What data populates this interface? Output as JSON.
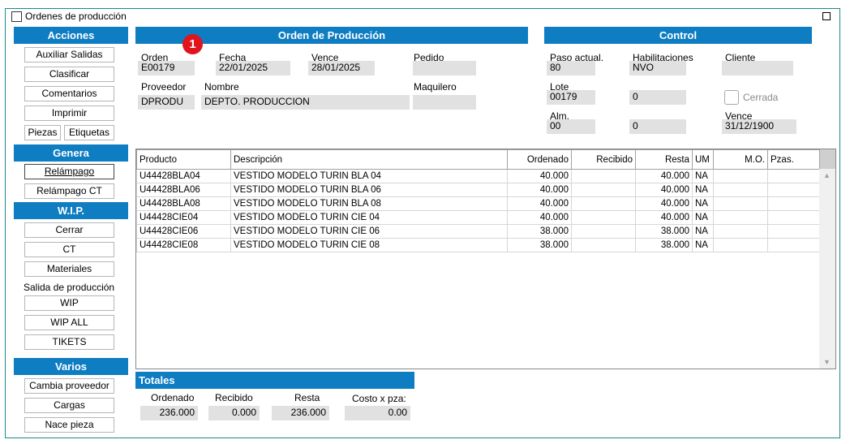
{
  "window": {
    "title": "Ordenes de producción"
  },
  "sidebar": {
    "acciones": {
      "title": "Acciones",
      "auxiliar": "Auxiliar Salidas",
      "clasificar": "Clasificar",
      "comentarios": "Comentarios",
      "imprimir": "Imprimir",
      "piezas": "Piezas",
      "etiquetas": "Etiquetas"
    },
    "genera": {
      "title": "Genera",
      "relampago": "Relámpago",
      "relampago_ct": "Relámpago CT"
    },
    "wip": {
      "title": "W.I.P.",
      "cerrar": "Cerrar",
      "ct": "CT",
      "materiales": "Materiales",
      "salida_label": "Salida de producción",
      "wip": "WIP",
      "wip_all": "WIP ALL",
      "tikets": "TIKETS"
    },
    "varios": {
      "title": "Varios",
      "cambia": "Cambia proveedor",
      "cargas": "Cargas",
      "nace": "Nace pieza"
    }
  },
  "badge": "1",
  "orden": {
    "title": "Orden de Producción",
    "orden_label": "Orden",
    "orden_value": "E00179",
    "fecha_label": "Fecha",
    "fecha_value": "22/01/2025",
    "vence_label": "Vence",
    "vence_value": "28/01/2025",
    "pedido_label": "Pedido",
    "pedido_value": "",
    "proveedor_label": "Proveedor",
    "proveedor_value": "DPRODU",
    "nombre_label": "Nombre",
    "nombre_value": "DEPTO. PRODUCCION",
    "maquilero_label": "Maquilero",
    "maquilero_value": ""
  },
  "control": {
    "title": "Control",
    "paso_label": "Paso actual.",
    "paso_value": "80",
    "hab_label": "Habilitaciones",
    "hab_value": "NVO",
    "cliente_label": "Cliente",
    "cliente_value": "",
    "lote_label": "Lote",
    "lote_value": "00179",
    "lote_extra": "0",
    "cerrada_label": "Cerrada",
    "alm_label": "Alm.",
    "alm_value": "00",
    "alm_extra": "0",
    "vence_label": "Vence",
    "vence_value": "31/12/1900"
  },
  "table": {
    "headers": [
      "Producto",
      "Descripción",
      "Ordenado",
      "Recibido",
      "Resta",
      "UM",
      "M.O.",
      "Pzas."
    ],
    "rows": [
      [
        "U44428BLA04",
        "VESTIDO MODELO TURIN BLA 04",
        "40.000",
        "",
        "40.000",
        "NA",
        "",
        ""
      ],
      [
        "U44428BLA06",
        "VESTIDO MODELO TURIN BLA 06",
        "40.000",
        "",
        "40.000",
        "NA",
        "",
        ""
      ],
      [
        "U44428BLA08",
        "VESTIDO MODELO TURIN BLA 08",
        "40.000",
        "",
        "40.000",
        "NA",
        "",
        ""
      ],
      [
        "U44428CIE04",
        "VESTIDO MODELO TURIN CIE 04",
        "40.000",
        "",
        "40.000",
        "NA",
        "",
        ""
      ],
      [
        "U44428CIE06",
        "VESTIDO MODELO TURIN CIE 06",
        "38.000",
        "",
        "38.000",
        "NA",
        "",
        ""
      ],
      [
        "U44428CIE08",
        "VESTIDO MODELO TURIN CIE 08",
        "38.000",
        "",
        "38.000",
        "NA",
        "",
        ""
      ]
    ]
  },
  "totales": {
    "title": "Totales",
    "ordenado_label": "Ordenado",
    "ordenado_value": "236.000",
    "recibido_label": "Recibido",
    "recibido_value": "0.000",
    "resta_label": "Resta",
    "resta_value": "236.000",
    "costo_label": "Costo x pza:",
    "costo_value": "0.00"
  }
}
